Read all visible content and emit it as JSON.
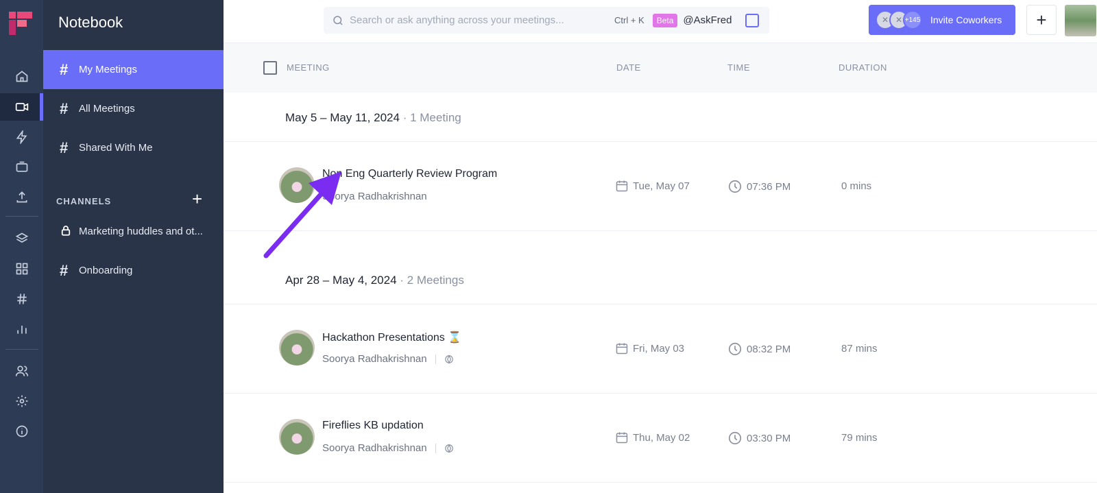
{
  "app": {
    "logo": "fireflies-logo"
  },
  "rail": {
    "items": [
      {
        "name": "home-icon"
      },
      {
        "name": "video-icon"
      },
      {
        "name": "lightning-icon"
      },
      {
        "name": "upload-meetings-icon"
      },
      {
        "name": "upload-icon"
      },
      {
        "name": "layers-icon"
      },
      {
        "name": "grid-icon"
      },
      {
        "name": "hash-icon"
      },
      {
        "name": "analytics-icon"
      },
      {
        "name": "people-icon"
      },
      {
        "name": "settings-icon"
      },
      {
        "name": "info-icon"
      }
    ]
  },
  "sidebar": {
    "title": "Notebook",
    "items": [
      {
        "label": "My Meetings",
        "active": true
      },
      {
        "label": "All Meetings"
      },
      {
        "label": "Shared With Me"
      }
    ],
    "channels_label": "CHANNELS",
    "channels": [
      {
        "label": "Marketing huddles and ot...",
        "icon": "lock-icon"
      },
      {
        "label": "Onboarding",
        "icon": "hash-icon"
      }
    ]
  },
  "topbar": {
    "search_placeholder": "Search or ask anything across your meetings...",
    "shortcut": "Ctrl + K",
    "beta": "Beta",
    "askfred": "@AskFred",
    "invite_count": "+145",
    "invite_label": "Invite Coworkers",
    "plus": "+"
  },
  "table": {
    "headers": {
      "meeting": "MEETING",
      "date": "DATE",
      "time": "TIME",
      "duration": "DURATION"
    }
  },
  "groups": [
    {
      "range": "May 5 – May 11, 2024",
      "count": "1 Meeting",
      "meetings": [
        {
          "title": "Non Eng Quarterly Review Program",
          "owner": "Soorya Radhakrishnan",
          "date": "Tue, May 07",
          "time": "07:36 PM",
          "duration": "0 mins"
        }
      ]
    },
    {
      "range": "Apr 28 – May 4, 2024",
      "count": "2 Meetings",
      "meetings": [
        {
          "title": "Hackathon Presentations ⌛",
          "owner": "Soorya Radhakrishnan",
          "date": "Fri, May 03",
          "time": "08:32 PM",
          "duration": "87 mins"
        },
        {
          "title": "Fireflies KB updation",
          "owner": "Soorya Radhakrishnan",
          "date": "Thu, May 02",
          "time": "03:30 PM",
          "duration": "79 mins"
        }
      ]
    }
  ],
  "colors": {
    "accent": "#6a6df8",
    "sidebar": "#293448",
    "rail": "#2e3b55",
    "arrow": "#7a2cf0"
  }
}
